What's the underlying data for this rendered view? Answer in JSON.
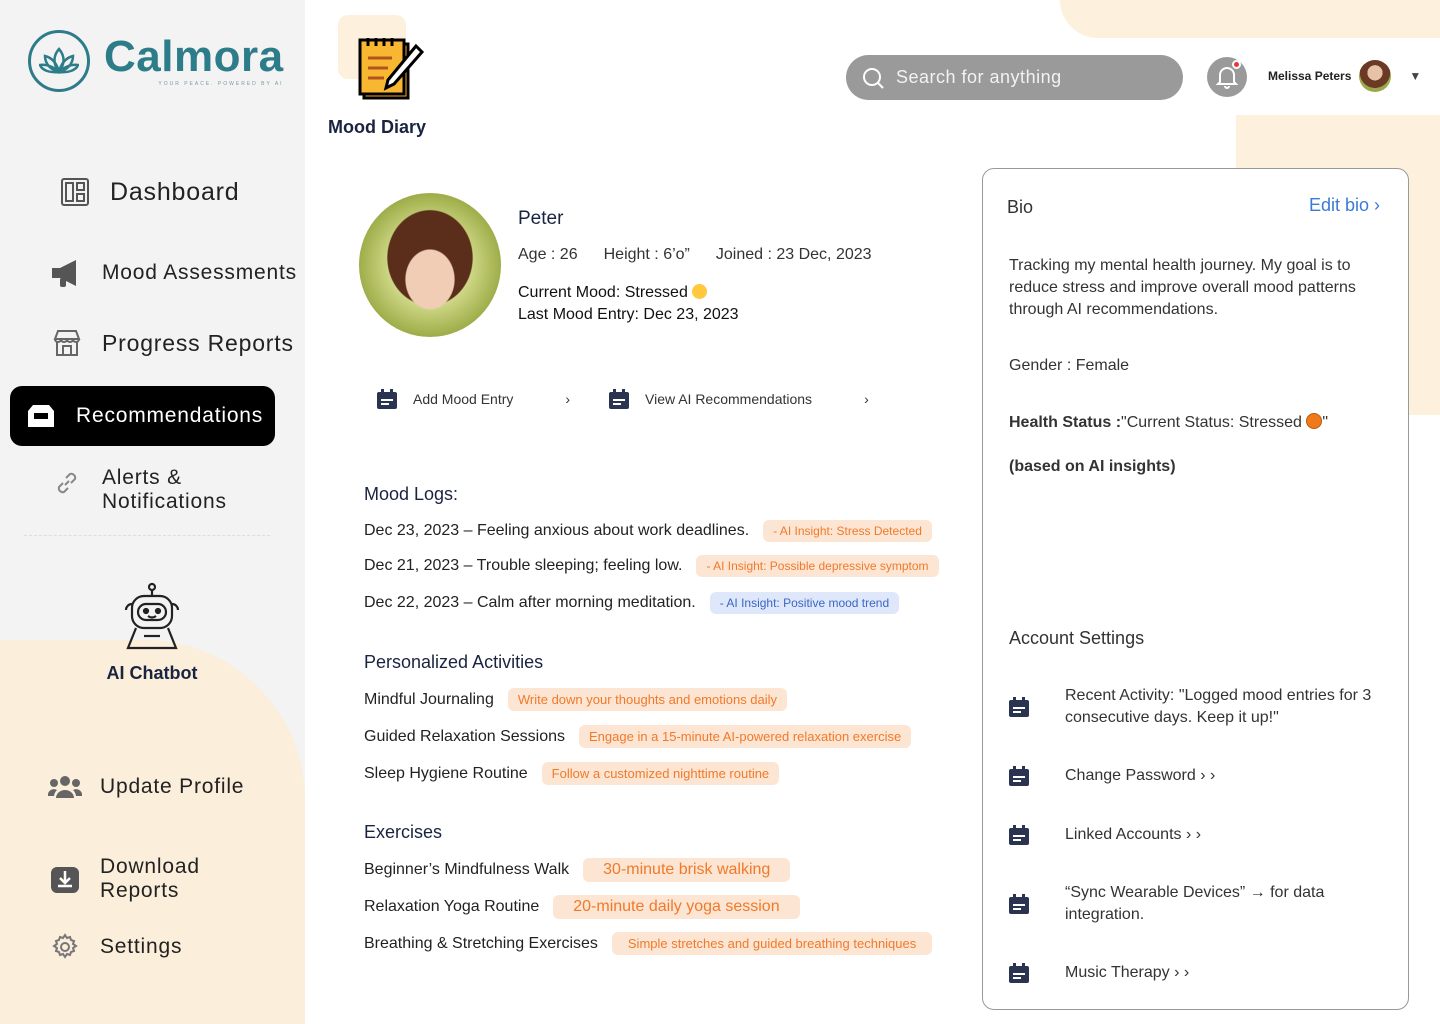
{
  "brand": {
    "name": "Calmora",
    "tagline": "YOUR PEACE. POWERED BY AI"
  },
  "header": {
    "section_title": "Mood Diary",
    "search_placeholder": "Search for anything",
    "user_name": "Melissa Peters"
  },
  "sidebar": {
    "items": [
      {
        "label": "Dashboard",
        "icon": "dashboard-icon"
      },
      {
        "label": "Mood Assessments",
        "icon": "megaphone-icon"
      },
      {
        "label": "Progress Reports",
        "icon": "store-icon"
      },
      {
        "label": "Recommendations",
        "icon": "inbox-icon",
        "active": true
      },
      {
        "label": "Alerts &\nNotifications",
        "icon": "link-icon"
      }
    ],
    "chatbot_label": "AI Chatbot",
    "bottom_items": [
      {
        "label": "Update Profile",
        "icon": "users-icon"
      },
      {
        "label": "Download\nReports",
        "icon": "download-icon"
      },
      {
        "label": "Settings",
        "icon": "gear-icon"
      }
    ]
  },
  "profile": {
    "name": "Peter",
    "age": "Age : 26",
    "height": "Height : 6’o”",
    "joined": "Joined : 23 Dec, 2023",
    "current_mood": "Current Mood: Stressed",
    "last_entry": "Last Mood Entry: Dec 23, 2023"
  },
  "actions": {
    "add_entry": "Add Mood Entry",
    "view_recs": "View AI Recommendations"
  },
  "mood_logs": {
    "title": "Mood Logs:",
    "entries": [
      {
        "text": "Dec 23, 2023 – Feeling anxious about work deadlines.",
        "insight": "- AI Insight: Stress Detected"
      },
      {
        "text": "Dec 21, 2023 – Trouble sleeping; feeling low.",
        "insight": "- AI Insight: Possible depressive symptom"
      },
      {
        "text": "Dec 22, 2023 – Calm after morning meditation.",
        "insight": "- AI Insight: Positive mood trend"
      }
    ]
  },
  "activities": {
    "title": "Personalized Activities",
    "items": [
      {
        "name": "Mindful Journaling",
        "desc": "Write down your thoughts and emotions daily"
      },
      {
        "name": "Guided Relaxation Sessions",
        "desc": "Engage in a 15-minute AI-powered relaxation exercise"
      },
      {
        "name": "Sleep Hygiene Routine",
        "desc": "Follow a customized nighttime routine"
      }
    ]
  },
  "exercises": {
    "title": "Exercises",
    "items": [
      {
        "name": "Beginner’s Mindfulness Walk",
        "desc": "30-minute brisk walking"
      },
      {
        "name": "Relaxation Yoga Routine",
        "desc": "20-minute daily yoga session"
      },
      {
        "name": "Breathing & Stretching Exercises",
        "desc": "Simple stretches and guided breathing techniques"
      }
    ]
  },
  "bio": {
    "title": "Bio",
    "edit_label": "Edit bio ›",
    "text": "Tracking my mental health journey. My goal is to reduce stress and improve overall mood patterns through AI recommendations.",
    "gender": "Gender : Female",
    "health_label": "Health Status :",
    "health_value": "\"Current Status: Stressed",
    "health_close": "\"",
    "based_on": "(based on AI insights)"
  },
  "account": {
    "title": "Account Settings",
    "items": [
      "Recent Activity: \"Logged mood entries for 3 consecutive days. Keep it up!\"",
      "Change Password › ›",
      "Linked Accounts › ›",
      "“Sync Wearable Devices” → for data integration.",
      "Music Therapy › ›"
    ]
  },
  "colors": {
    "brand": "#2d7c89",
    "accent_orange": "#f07a2a",
    "pill_bg": "#fde5d3",
    "insight_blue": "#3a66c4",
    "active_nav": "#000000"
  }
}
